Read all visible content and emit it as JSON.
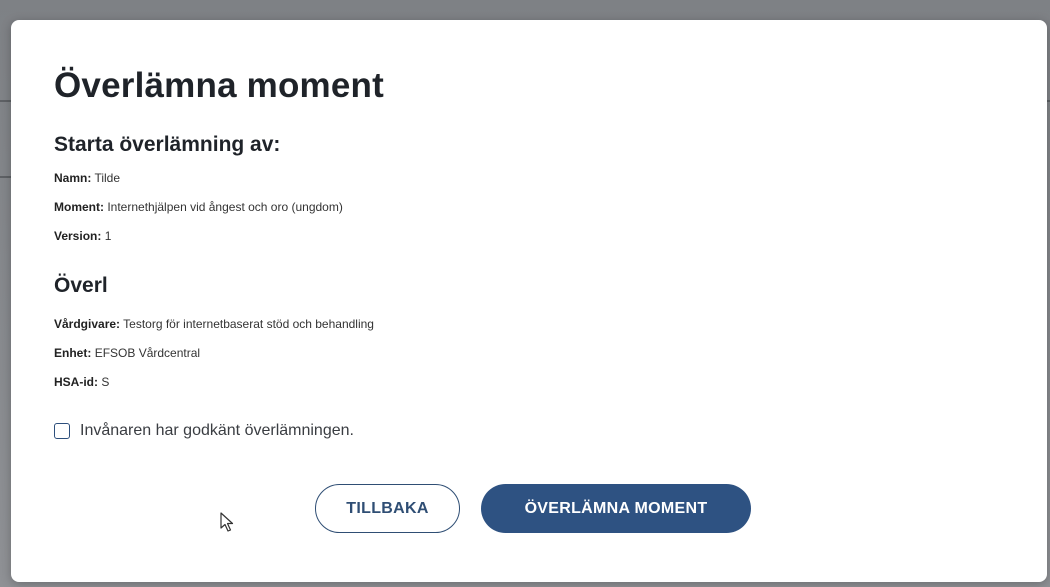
{
  "modal": {
    "title": "Överlämna moment",
    "start_section": {
      "heading": "Starta överlämning av:",
      "fields": [
        {
          "label": "Namn:",
          "value": "Tilde"
        },
        {
          "label": "Moment:",
          "value": "Internethjälpen vid ångest och oro (ungdom)"
        },
        {
          "label": "Version:",
          "value": "1"
        }
      ]
    },
    "receiver_section": {
      "heading": "Överl",
      "fields": [
        {
          "label": "Vårdgivare:",
          "value": "Testorg för internetbaserat stöd och behandling"
        },
        {
          "label": "Enhet:",
          "value": "EFSOB Vårdcentral"
        },
        {
          "label": "HSA-id:",
          "value": "S"
        }
      ]
    },
    "consent_checkbox": {
      "label": "Invånaren har godkänt överlämningen.",
      "checked": false
    },
    "buttons": {
      "back_label": "TILLBAKA",
      "submit_label": "ÖVERLÄMNA MOMENT"
    }
  },
  "colors": {
    "primary": "#2e5282",
    "text": "#1f2329",
    "overlay": "#8a8c90"
  },
  "icons": {
    "cursor": "mouse-pointer-icon"
  }
}
